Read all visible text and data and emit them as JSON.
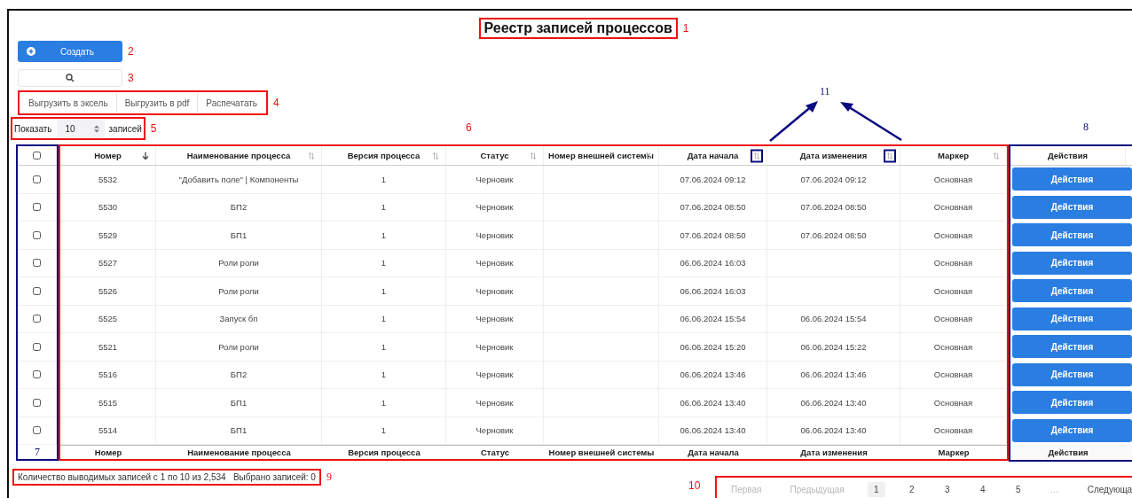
{
  "page_title": {
    "text": "Реестр записей процессов",
    "callout": "1"
  },
  "create_button": {
    "label": "Создать",
    "callout": "2"
  },
  "search": {
    "callout": "3"
  },
  "export": {
    "buttons": [
      "Выгрузить в эксель",
      "Выгрузить в pdf",
      "Распечатать"
    ],
    "callout": "4"
  },
  "page_size": {
    "prefix": "Показать",
    "value": "10",
    "suffix": "записей",
    "callout": "5"
  },
  "table": {
    "callout": "6",
    "select_callout": "7",
    "actions_callout": "8",
    "sort_callout": "11",
    "select_all": {
      "checked": false
    },
    "columns": [
      {
        "label": "Номер",
        "sorted_desc": true,
        "highlighted": false
      },
      {
        "label": "Наименование процесса",
        "sorted_desc": false,
        "highlighted": false
      },
      {
        "label": "Версия процесса",
        "sorted_desc": false,
        "highlighted": false
      },
      {
        "label": "Статус",
        "sorted_desc": false,
        "highlighted": false
      },
      {
        "label": "Номер внешней системы",
        "sorted_desc": false,
        "highlighted": false
      },
      {
        "label": "Дата начала",
        "sorted_desc": false,
        "highlighted": true
      },
      {
        "label": "Дата изменения",
        "sorted_desc": false,
        "highlighted": true
      },
      {
        "label": "Маркер",
        "sorted_desc": false,
        "highlighted": false
      }
    ],
    "actions_header": "Действия",
    "rows": [
      {
        "checked": false,
        "cells": [
          "5532",
          "\"Добавить поле\" | Компоненты",
          "1",
          "Черновик",
          "",
          "07.06.2024 09:12",
          "07.06.2024 09:12",
          "Основная"
        ],
        "action": "Действия"
      },
      {
        "checked": false,
        "cells": [
          "5530",
          "БП2",
          "1",
          "Черновик",
          "",
          "07.06.2024 08:50",
          "07.06.2024 08:50",
          "Основная"
        ],
        "action": "Действия"
      },
      {
        "checked": false,
        "cells": [
          "5529",
          "БП1",
          "1",
          "Черновик",
          "",
          "07.06.2024 08:50",
          "07.06.2024 08:50",
          "Основная"
        ],
        "action": "Действия"
      },
      {
        "checked": false,
        "cells": [
          "5527",
          "Роли роли",
          "1",
          "Черновик",
          "",
          "06.06.2024 16:03",
          "",
          "Основная"
        ],
        "action": "Действия"
      },
      {
        "checked": false,
        "cells": [
          "5526",
          "Роли роли",
          "1",
          "Черновик",
          "",
          "06.06.2024 16:03",
          "",
          "Основная"
        ],
        "action": "Действия"
      },
      {
        "checked": false,
        "cells": [
          "5525",
          "Запуск бп",
          "1",
          "Черновик",
          "",
          "06.06.2024 15:54",
          "06.06.2024 15:54",
          "Основная"
        ],
        "action": "Действия"
      },
      {
        "checked": false,
        "cells": [
          "5521",
          "Роли роли",
          "1",
          "Черновик",
          "",
          "06.06.2024 15:20",
          "06.06.2024 15:22",
          "Основная"
        ],
        "action": "Действия"
      },
      {
        "checked": false,
        "cells": [
          "5516",
          "БП2",
          "1",
          "Черновик",
          "",
          "06.06.2024 13:46",
          "06.06.2024 13:46",
          "Основная"
        ],
        "action": "Действия"
      },
      {
        "checked": false,
        "cells": [
          "5515",
          "БП1",
          "1",
          "Черновик",
          "",
          "06.06.2024 13:40",
          "06.06.2024 13:40",
          "Основная"
        ],
        "action": "Действия"
      },
      {
        "checked": false,
        "cells": [
          "5514",
          "БП1",
          "1",
          "Черновик",
          "",
          "06.06.2024 13:40",
          "06.06.2024 13:40",
          "Основная"
        ],
        "action": "Действия"
      }
    ],
    "footer": [
      "Номер",
      "Наименование процесса",
      "Версия процесса",
      "Статус",
      "Номер внешней системы",
      "Дата начала",
      "Дата изменения",
      "Маркер"
    ],
    "actions_footer": "Действия"
  },
  "summary": {
    "text": "Количество выводимых записей с 1 по 10 из 2,534   Выбрано записей: 0",
    "callout": "9"
  },
  "pagination": {
    "callout": "10",
    "items": [
      {
        "label": "Первая",
        "kind": "nav",
        "disabled": true
      },
      {
        "label": "Предыдущая",
        "kind": "nav",
        "disabled": true
      },
      {
        "label": "1",
        "kind": "page",
        "selected": true
      },
      {
        "label": "2",
        "kind": "page",
        "selected": false
      },
      {
        "label": "3",
        "kind": "page",
        "selected": false
      },
      {
        "label": "4",
        "kind": "page",
        "selected": false
      },
      {
        "label": "5",
        "kind": "page",
        "selected": false
      },
      {
        "label": "…",
        "kind": "ellipsis"
      },
      {
        "label": "Следующа",
        "kind": "nav",
        "disabled": false
      }
    ]
  }
}
